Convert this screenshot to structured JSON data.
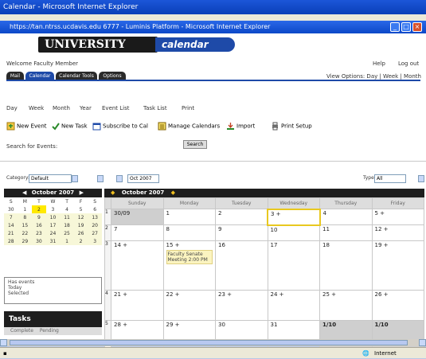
{
  "browser": {
    "outer_title": "Calendar - Microsoft Internet Explorer",
    "inner_title": "https://tan.ntrss.ucdavis.edu 6777 - Luminis Platform - Microsoft Internet Explorer",
    "status_text": "Internet"
  },
  "header": {
    "logo_text": "UNIVERSITY",
    "logo_suffix": "calendar",
    "welcome": "Welcome Faculty Member",
    "help_link": "Help",
    "logout_link": "Log out"
  },
  "tabs": [
    {
      "label": "Mail"
    },
    {
      "label": "Calendar"
    },
    {
      "label": "Calendar Tools"
    },
    {
      "label": "Options"
    }
  ],
  "view_options_label": "View Options: Day | Week | Month",
  "views": [
    "Day",
    "Week",
    "Month",
    "Year",
    "Event List",
    "Task List",
    "Print"
  ],
  "toolbar": [
    {
      "icon": "new-event-icon",
      "label": "New Event"
    },
    {
      "icon": "new-task-icon",
      "label": "New Task"
    },
    {
      "icon": "subscribe-icon",
      "label": "Subscribe to Cal"
    },
    {
      "icon": "calendar-icon",
      "label": "Manage Calendars"
    },
    {
      "icon": "import-icon",
      "label": "Import"
    },
    {
      "icon": "print-icon",
      "label": "Print Setup"
    }
  ],
  "search": {
    "label": "Search for Events:",
    "button": "Search"
  },
  "filters": {
    "category_label": "Category:",
    "category_value": "Default",
    "date_value": "Oct 2007",
    "type_label": "Type:",
    "type_value": "All"
  },
  "mini_calendar": {
    "title": "October 2007",
    "weekdays": [
      "S",
      "M",
      "T",
      "W",
      "T",
      "F",
      "S"
    ],
    "weeks": [
      [
        "30",
        "1",
        "2",
        "3",
        "4",
        "5",
        "6"
      ],
      [
        "7",
        "8",
        "9",
        "10",
        "11",
        "12",
        "13"
      ],
      [
        "14",
        "15",
        "16",
        "17",
        "18",
        "19",
        "20"
      ],
      [
        "21",
        "22",
        "23",
        "24",
        "25",
        "26",
        "27"
      ],
      [
        "28",
        "29",
        "30",
        "31",
        "1",
        "2",
        "3"
      ]
    ],
    "legend": [
      "Has events",
      "Today",
      "Selected"
    ]
  },
  "month_view": {
    "title": "October 2007",
    "weekdays": [
      "Sunday",
      "Monday",
      "Tuesday",
      "Wednesday",
      "Thursday",
      "Friday"
    ],
    "weeks": [
      {
        "wk": "1",
        "days": [
          "30/09",
          "1",
          "2",
          "3 +",
          "4",
          "5 +"
        ]
      },
      {
        "wk": "2",
        "days": [
          "7",
          "8",
          "9",
          "10",
          "11",
          "12 +"
        ]
      },
      {
        "wk": "3",
        "days": [
          "14 +",
          "15 +",
          "16",
          "17",
          "18",
          "19 +"
        ]
      },
      {
        "wk": "4",
        "days": [
          "21 +",
          "22 +",
          "23 +",
          "24 +",
          "25 +",
          "26 +"
        ]
      },
      {
        "wk": "5",
        "days": [
          "28 +",
          "29 +",
          "30",
          "31",
          "1/10",
          "1/10"
        ]
      }
    ],
    "event": {
      "day": "15",
      "text": "Faculty Senate Meeting 2:00 PM"
    }
  },
  "tasks": {
    "title": "Tasks",
    "tabs": [
      "Complete",
      "Pending"
    ]
  }
}
